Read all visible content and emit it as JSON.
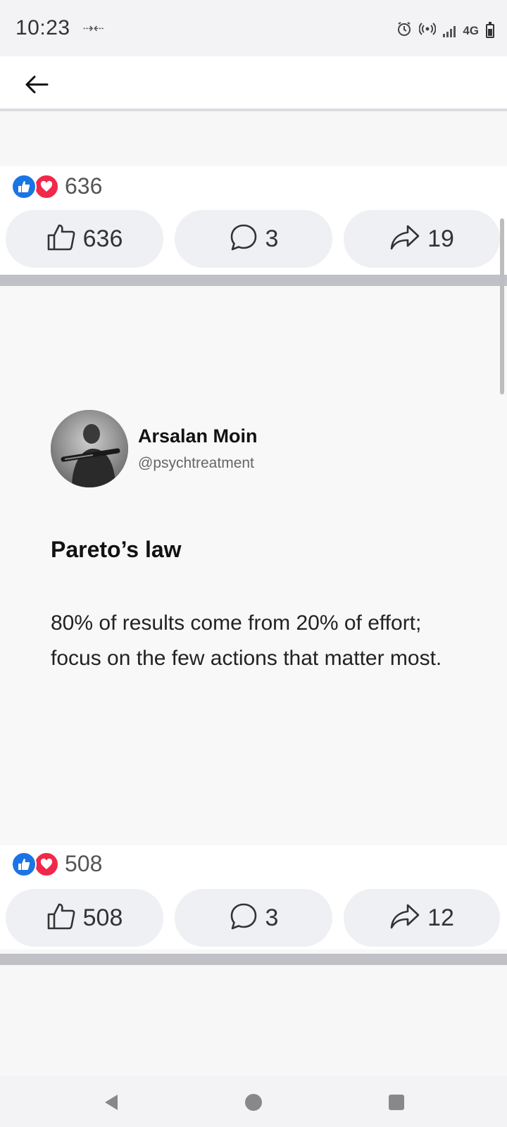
{
  "status_bar": {
    "time": "10:23",
    "network": "4G",
    "icons": [
      "data-transfer-icon",
      "alarm-icon",
      "hotspot-icon",
      "signal-icon",
      "battery-icon"
    ]
  },
  "app_bar": {
    "back_icon": "back-arrow-icon"
  },
  "posts": [
    {
      "reactions_count": "636",
      "like_label": "636",
      "comment_label": "3",
      "share_label": "19"
    },
    {
      "author_name": "Arsalan Moin",
      "author_handle": "@psychtreatment",
      "title": "Pareto’s law",
      "body": "80% of results come from 20% of effort; focus on the few actions that matter most.",
      "reactions_count": "508",
      "like_label": "508",
      "comment_label": "3",
      "share_label": "12"
    }
  ],
  "colors": {
    "like_blue": "#1b74e4",
    "love_red": "#f0284a",
    "divider": "#bfc1c6"
  }
}
